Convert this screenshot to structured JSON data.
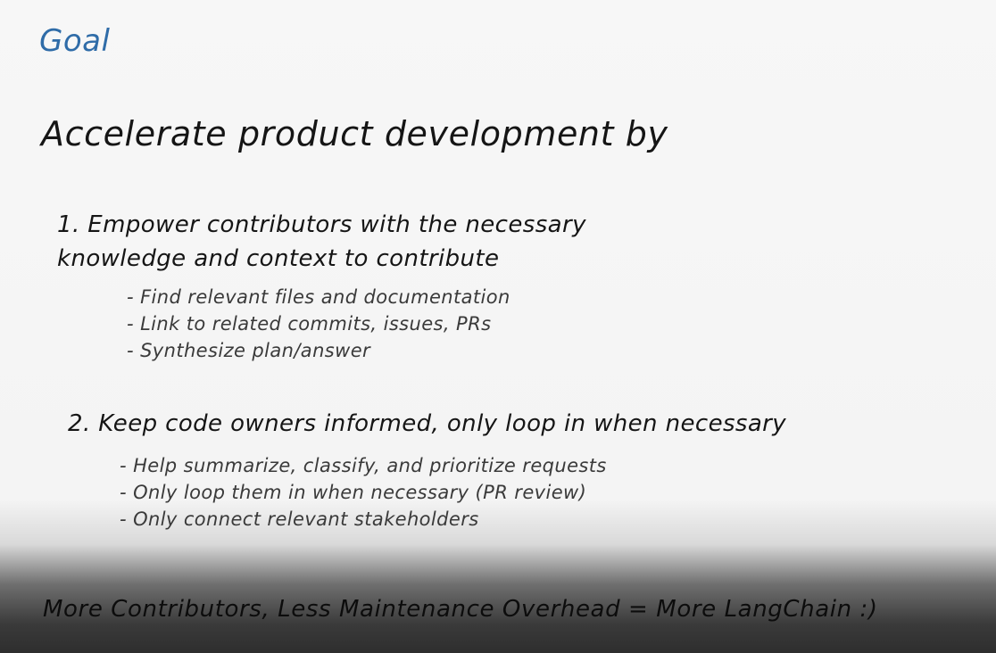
{
  "slide": {
    "title": "Goal",
    "headline": "Accelerate product development by",
    "goals": [
      {
        "heading_line1": "1. Empower contributors with the necessary",
        "heading_line2": "knowledge and context to contribute",
        "points": [
          "Find relevant files and documentation",
          "Link to related commits, issues, PRs",
          "Synthesize plan/answer"
        ]
      },
      {
        "heading": "2. Keep code owners informed, only loop in when necessary",
        "points": [
          "Help summarize, classify, and prioritize requests",
          "Only loop them in when necessary (PR review)",
          "Only connect relevant stakeholders"
        ]
      }
    ],
    "footer": "More Contributors, Less Maintenance Overhead = More LangChain :)"
  },
  "colors": {
    "title": "#2f6ca8",
    "text": "#151515",
    "background": "#f6f6f6"
  }
}
